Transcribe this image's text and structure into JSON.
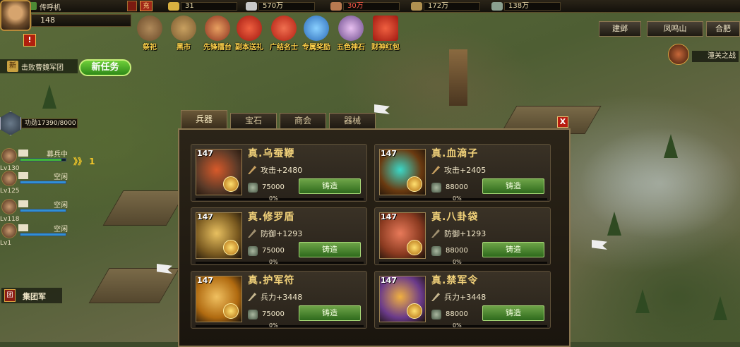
{
  "top": {
    "chat_label": "传呼机",
    "red_btn": "充",
    "resources": [
      {
        "icon": "gold-icon",
        "value": "31",
        "color": "#e8d8a8"
      },
      {
        "icon": "silver-icon",
        "value": "570万",
        "color": "#e8d8a8"
      },
      {
        "icon": "food-icon",
        "value": "30万",
        "color": "#ff5a4a"
      },
      {
        "icon": "wood-icon",
        "value": "172万",
        "color": "#e8d8a8"
      },
      {
        "icon": "iron-icon",
        "value": "138万",
        "color": "#e8d8a8"
      }
    ]
  },
  "player": {
    "level": "148",
    "alert": "!"
  },
  "task": {
    "badge": "新",
    "text": "击败曹魏军团",
    "new_task_button": "新任务"
  },
  "merit": {
    "text": "功勋17390/8000"
  },
  "generals": [
    {
      "level": "Lv130",
      "status": "募兵中",
      "bar_pct": 0.9,
      "bar_color": "#3fb63a"
    },
    {
      "level": "Lv125",
      "status": "空闲",
      "bar_pct": 1,
      "bar_color": "#2f8fd8"
    },
    {
      "level": "Lv118",
      "status": "空闲",
      "bar_pct": 1,
      "bar_color": "#2f8fd8"
    },
    {
      "level": "Lv1",
      "status": "空闲",
      "bar_pct": 1,
      "bar_color": "#2f8fd8"
    }
  ],
  "speed_indicator": "》》 1",
  "army_button": "集团军",
  "army_icon": "团",
  "functions": [
    {
      "label": "祭祀",
      "icon": "altar-icon",
      "color": "#6a4a2a"
    },
    {
      "label": "黑市",
      "icon": "black-market-icon",
      "color": "#7a5a30"
    },
    {
      "label": "先锋擂台",
      "icon": "arena-icon",
      "color": "#8a3020"
    },
    {
      "label": "副本送礼",
      "icon": "gift-icon",
      "color": "#c02818"
    },
    {
      "label": "广结名士",
      "icon": "lantern-icon",
      "color": "#c02818"
    },
    {
      "label": "专属奖励",
      "icon": "vip-icon",
      "color": "#3a8ad8"
    },
    {
      "label": "五色神石",
      "icon": "gems-icon",
      "color": "#9a6ab8"
    },
    {
      "label": "财神红包",
      "icon": "red-packet-icon",
      "color": "#c82010"
    }
  ],
  "location": {
    "left": "建邺",
    "center": "凤鸣山",
    "right": "合肥",
    "battle": "潼关之战"
  },
  "shop": {
    "tabs": [
      "兵器",
      "宝石",
      "商会",
      "器械"
    ],
    "active_tab": 0,
    "close": "X",
    "forge_label": "铸造",
    "items": [
      {
        "level": "147",
        "name": "真.乌蚕鞭",
        "stat": "攻击+2480",
        "stat_icon": "sword-icon",
        "price": "75000",
        "progress": "0%",
        "c1": "#d85a2a",
        "c2": "#5a3a28"
      },
      {
        "level": "147",
        "name": "真.血滴子",
        "stat": "攻击+2405",
        "stat_icon": "sword-icon",
        "price": "88000",
        "progress": "0%",
        "c1": "#3ad8c8",
        "c2": "#6a3a10"
      },
      {
        "level": "147",
        "name": "真.修罗盾",
        "stat": "防御+1293",
        "stat_icon": "shield-icon",
        "price": "75000",
        "progress": "0%",
        "c1": "#e8c060",
        "c2": "#7a5a20"
      },
      {
        "level": "147",
        "name": "真.八卦袋",
        "stat": "防御+1293",
        "stat_icon": "shield-icon",
        "price": "88000",
        "progress": "0%",
        "c1": "#e87a5a",
        "c2": "#8a3a20"
      },
      {
        "level": "147",
        "name": "真.护军符",
        "stat": "兵力+3448",
        "stat_icon": "troops-icon",
        "price": "75000",
        "progress": "0%",
        "c1": "#f0c060",
        "c2": "#b06a10"
      },
      {
        "level": "147",
        "name": "真.禁军令",
        "stat": "兵力+3448",
        "stat_icon": "troops-icon",
        "price": "88000",
        "progress": "0%",
        "c1": "#f0b040",
        "c2": "#6a3a8a"
      }
    ]
  }
}
